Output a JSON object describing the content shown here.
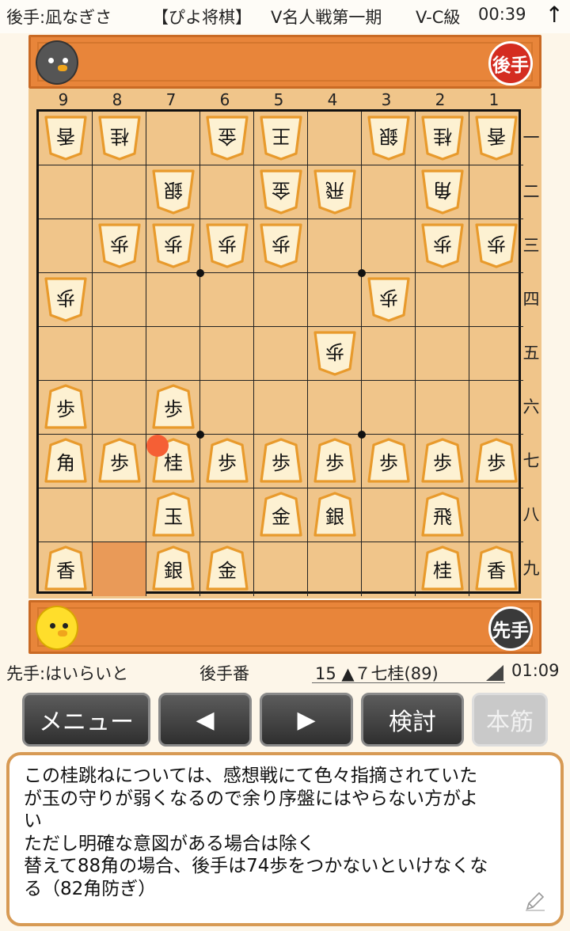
{
  "header": {
    "gote_player": "後手:凪なぎさ",
    "app_title": "【ぴよ将棋】",
    "match_name": "V名人戦第一期",
    "rank_class": "V-C級",
    "gote_time": "00:39",
    "up_icon": "arrow-up-icon"
  },
  "gote_hand": {
    "badge": "後手"
  },
  "sente_hand": {
    "badge": "先手"
  },
  "board": {
    "files": [
      "9",
      "8",
      "7",
      "6",
      "5",
      "4",
      "3",
      "2",
      "1"
    ],
    "ranks": [
      "一",
      "二",
      "三",
      "四",
      "五",
      "六",
      "七",
      "八",
      "九"
    ],
    "highlight_square": "8九",
    "last_move_marker": "7七",
    "pieces": [
      {
        "sq": "9一",
        "k": "香",
        "o": "gote"
      },
      {
        "sq": "8一",
        "k": "桂",
        "o": "gote"
      },
      {
        "sq": "6一",
        "k": "金",
        "o": "gote"
      },
      {
        "sq": "5一",
        "k": "王",
        "o": "gote"
      },
      {
        "sq": "3一",
        "k": "銀",
        "o": "gote"
      },
      {
        "sq": "2一",
        "k": "桂",
        "o": "gote"
      },
      {
        "sq": "1一",
        "k": "香",
        "o": "gote"
      },
      {
        "sq": "7二",
        "k": "銀",
        "o": "gote"
      },
      {
        "sq": "5二",
        "k": "金",
        "o": "gote"
      },
      {
        "sq": "4二",
        "k": "飛",
        "o": "gote"
      },
      {
        "sq": "2二",
        "k": "角",
        "o": "gote"
      },
      {
        "sq": "8三",
        "k": "歩",
        "o": "gote"
      },
      {
        "sq": "7三",
        "k": "歩",
        "o": "gote"
      },
      {
        "sq": "6三",
        "k": "歩",
        "o": "gote"
      },
      {
        "sq": "5三",
        "k": "歩",
        "o": "gote"
      },
      {
        "sq": "2三",
        "k": "歩",
        "o": "gote"
      },
      {
        "sq": "1三",
        "k": "歩",
        "o": "gote"
      },
      {
        "sq": "9四",
        "k": "歩",
        "o": "gote"
      },
      {
        "sq": "3四",
        "k": "歩",
        "o": "gote"
      },
      {
        "sq": "4五",
        "k": "歩",
        "o": "gote"
      },
      {
        "sq": "9六",
        "k": "歩",
        "o": "sente"
      },
      {
        "sq": "7六",
        "k": "歩",
        "o": "sente"
      },
      {
        "sq": "9七",
        "k": "角",
        "o": "sente"
      },
      {
        "sq": "8七",
        "k": "歩",
        "o": "sente"
      },
      {
        "sq": "7七",
        "k": "桂",
        "o": "sente"
      },
      {
        "sq": "6七",
        "k": "歩",
        "o": "sente"
      },
      {
        "sq": "5七",
        "k": "歩",
        "o": "sente"
      },
      {
        "sq": "4七",
        "k": "歩",
        "o": "sente"
      },
      {
        "sq": "3七",
        "k": "歩",
        "o": "sente"
      },
      {
        "sq": "2七",
        "k": "歩",
        "o": "sente"
      },
      {
        "sq": "1七",
        "k": "歩",
        "o": "sente"
      },
      {
        "sq": "7八",
        "k": "玉",
        "o": "sente"
      },
      {
        "sq": "5八",
        "k": "金",
        "o": "sente"
      },
      {
        "sq": "4八",
        "k": "銀",
        "o": "sente"
      },
      {
        "sq": "2八",
        "k": "飛",
        "o": "sente"
      },
      {
        "sq": "9九",
        "k": "香",
        "o": "sente"
      },
      {
        "sq": "7九",
        "k": "銀",
        "o": "sente"
      },
      {
        "sq": "6九",
        "k": "金",
        "o": "sente"
      },
      {
        "sq": "2九",
        "k": "桂",
        "o": "sente"
      },
      {
        "sq": "1九",
        "k": "香",
        "o": "sente"
      }
    ]
  },
  "status": {
    "sente_player": "先手:はいらいと",
    "turn": "後手番",
    "move": "15 ▲７七桂(89)",
    "sente_time": "01:09"
  },
  "buttons": {
    "menu": "メニュー",
    "prev": "◀",
    "next": "▶",
    "analyze": "検討",
    "mainline": "本筋"
  },
  "comment": {
    "text": "この桂跳ねについては、感想戦にて色々指摘されていた\nが玉の守りが弱くなるので余り序盤にはやらない方がよ\nい\nただし明確な意図がある場合は除く\n替えて88角の場合、後手は74歩をつかないといけなくな\nる（82角防ぎ）",
    "edit_icon": "pencil-icon"
  },
  "colors": {
    "board": "#f0c58a",
    "hand_bar": "#e8853a",
    "highlight": "#e99a58",
    "marker": "#f55f35",
    "piece_face": "#fdf1d2",
    "piece_edge": "#e89a2c"
  }
}
